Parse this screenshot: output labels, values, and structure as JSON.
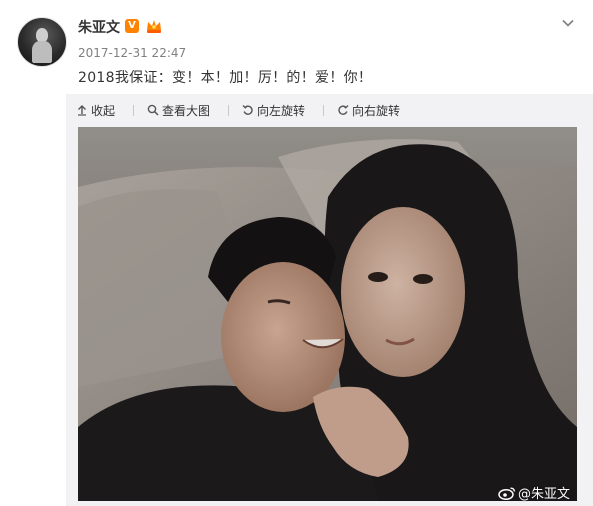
{
  "post": {
    "user_name": "朱亚文",
    "verified_badge": "V",
    "timestamp": "2017-12-31 22:47",
    "text": "2018我保证：变！本！加！厉！的！爱！你！"
  },
  "toolbar": {
    "collapse_label": "收起",
    "view_large_label": "查看大图",
    "rotate_left_label": "向左旋转",
    "rotate_right_label": "向右旋转"
  },
  "photo": {
    "watermark": "@朱亚文"
  },
  "icons": [
    "chevron-down-icon",
    "collapse-arrow-icon",
    "magnifier-icon",
    "rotate-left-icon",
    "rotate-right-icon",
    "weibo-logo-icon"
  ],
  "colors": {
    "accent": "#ff8200",
    "text": "#333333",
    "muted": "#808080",
    "media_bg": "#f2f2f5"
  }
}
